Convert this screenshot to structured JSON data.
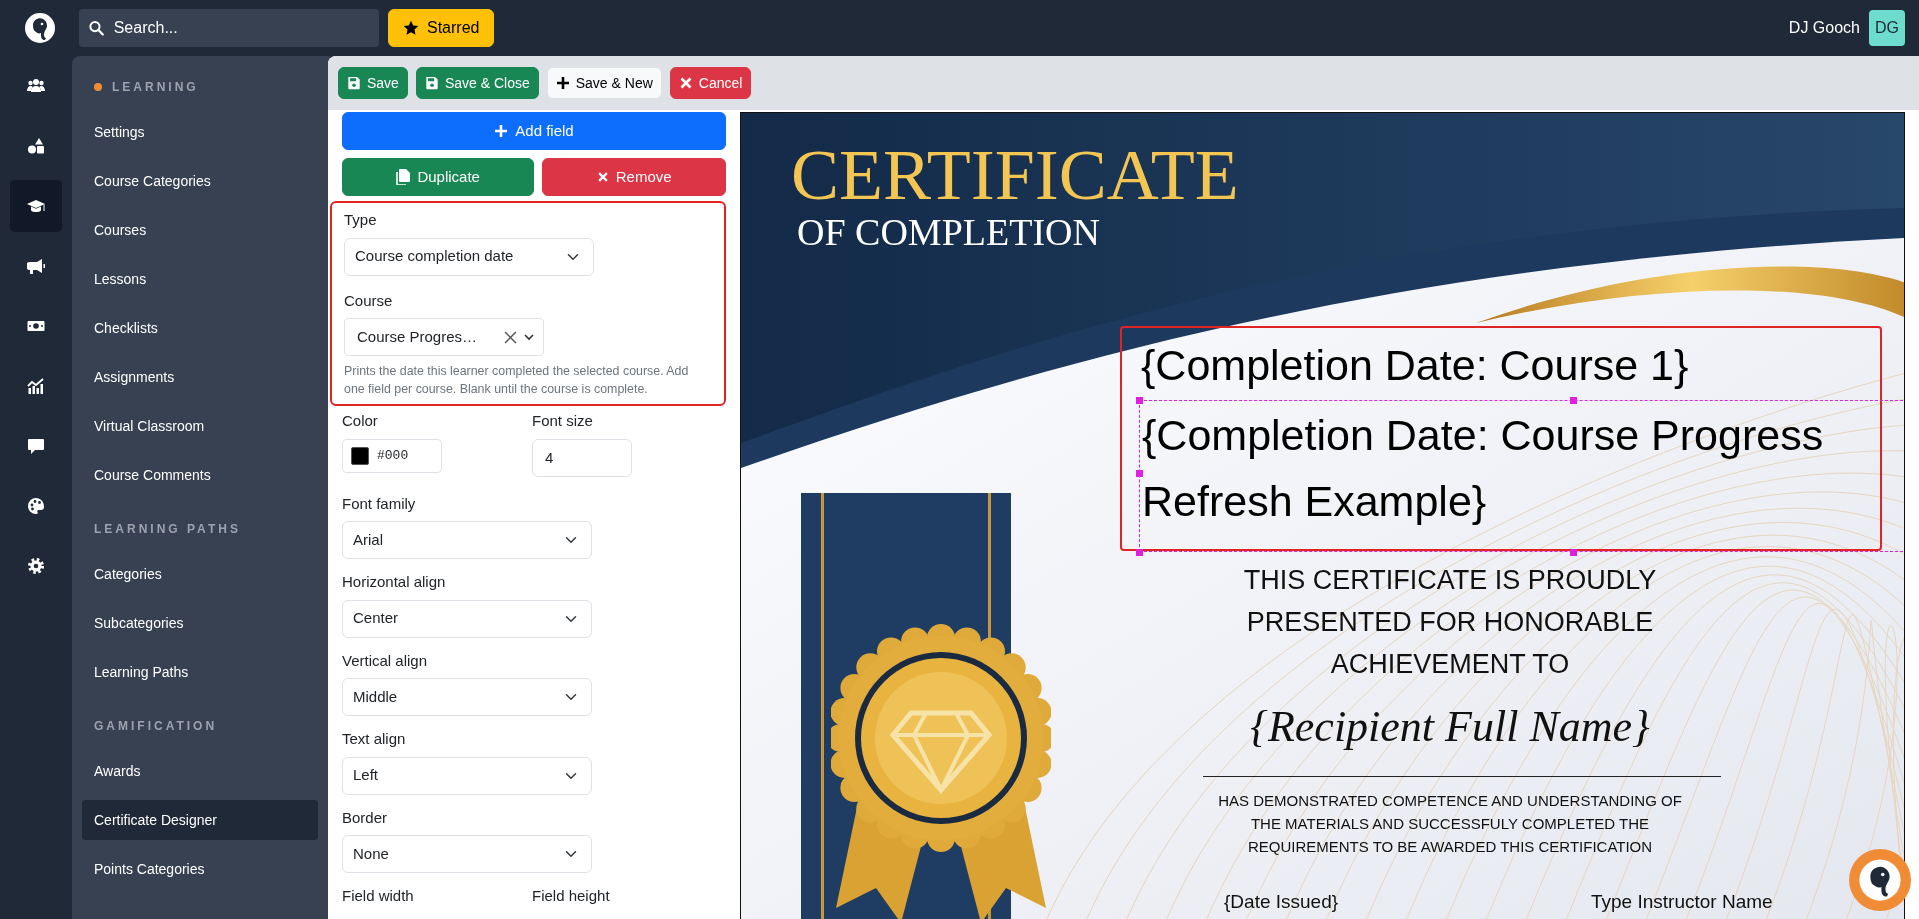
{
  "topbar": {
    "search": {
      "placeholder": "Search..."
    },
    "starred_button": "Starred",
    "user_name": "DJ Gooch",
    "avatar_initials": "DG"
  },
  "icon_rail": [
    {
      "selected": false
    },
    {
      "selected": false
    },
    {
      "selected": true
    },
    {
      "selected": false
    },
    {
      "selected": false
    },
    {
      "selected": false
    },
    {
      "selected": false
    },
    {
      "selected": false
    },
    {
      "selected": false
    }
  ],
  "sidebar": {
    "sections": [
      {
        "heading": "LEARNING",
        "current": true,
        "items": [
          {
            "label": "Settings",
            "selected": false
          },
          {
            "label": "Course Categories",
            "selected": false
          },
          {
            "label": "Courses",
            "selected": false
          },
          {
            "label": "Lessons",
            "selected": false
          },
          {
            "label": "Checklists",
            "selected": false
          },
          {
            "label": "Assignments",
            "selected": false
          },
          {
            "label": "Virtual Classroom",
            "selected": false
          },
          {
            "label": "Course Comments",
            "selected": false
          }
        ]
      },
      {
        "heading": "LEARNING PATHS",
        "current": false,
        "items": [
          {
            "label": "Categories",
            "selected": false
          },
          {
            "label": "Subcategories",
            "selected": false
          },
          {
            "label": "Learning Paths",
            "selected": false
          }
        ]
      },
      {
        "heading": "GAMIFICATION",
        "current": false,
        "items": [
          {
            "label": "Awards",
            "selected": false
          },
          {
            "label": "Certificate Designer",
            "selected": true
          },
          {
            "label": "Points Categories",
            "selected": false
          }
        ]
      }
    ]
  },
  "toolbar": {
    "buttons": [
      {
        "label": "Save",
        "kind": "save"
      },
      {
        "label": "Save & Close",
        "kind": "save"
      },
      {
        "label": "Save & New",
        "kind": "new"
      },
      {
        "label": "Cancel",
        "kind": "cancel"
      }
    ]
  },
  "field_panel": {
    "add_button": "Add field",
    "duplicate_button": "Duplicate",
    "remove_button": "Remove",
    "highlighted_group": {
      "type": {
        "label": "Type",
        "value": "Course completion date"
      },
      "course": {
        "label": "Course",
        "value": "Course Progres…",
        "clearable": true
      },
      "help": "Prints the date this learner completed the selected course. Add one field per course. Blank until the course is complete."
    },
    "color": {
      "label": "Color",
      "value": "#000"
    },
    "font_size": {
      "label": "Font size",
      "value": "4"
    },
    "selects": [
      {
        "label": "Font family",
        "value": "Arial"
      },
      {
        "label": "Horizontal align",
        "value": "Center"
      },
      {
        "label": "Vertical align",
        "value": "Middle"
      },
      {
        "label": "Text align",
        "value": "Left"
      },
      {
        "label": "Border",
        "value": "None"
      }
    ],
    "field_width_label": "Field width",
    "field_height_label": "Field height"
  },
  "certificate": {
    "title": "CERTIFICATE",
    "subtitle": "OF COMPLETION",
    "fields": [
      {
        "text": "{Completion Date: Course 1}",
        "selected": false
      },
      {
        "text": "{Completion Date: Course Progress Refresh Example}",
        "selected": true
      }
    ],
    "presented_lines": [
      "THIS CERTIFICATE IS PROUDLY",
      "PRESENTED FOR HONORABLE",
      "ACHIEVEMENT TO"
    ],
    "recipient": "{Recipient Full Name}",
    "body_lines": [
      "HAS DEMONSTRATED COMPETENCE AND UNDERSTANDING OF",
      "THE MATERIALS AND SUCCESSFULY COMPLETED THE",
      "REQUIREMENTS TO BE AWARDED THIS CERTIFICATION"
    ],
    "date_field": "{Date Issued}",
    "instructor_field": "Type Instructor Name"
  }
}
